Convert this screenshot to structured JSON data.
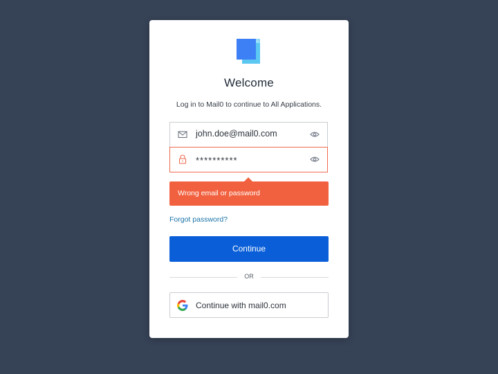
{
  "brand": {
    "logo_icon": "cube-logo-icon",
    "accent_color": "#3d82f6"
  },
  "login": {
    "title": "Welcome",
    "subtitle": "Log in to Mail0 to continue to All Applications.",
    "email": {
      "value": "john.doe@mail0.com",
      "icon": "envelope-icon"
    },
    "password": {
      "value": "**********",
      "icon": "lock-icon",
      "border_color": "#ee6a4e"
    },
    "error": {
      "message": "Wrong email or password",
      "color": "#f2613f"
    },
    "forgot_label": "Forgot password?",
    "continue_label": "Continue",
    "continue_color": "#0a5fd8",
    "divider_label": "OR",
    "social_label": "Continue with mail0.com",
    "social_icon": "google-icon"
  }
}
